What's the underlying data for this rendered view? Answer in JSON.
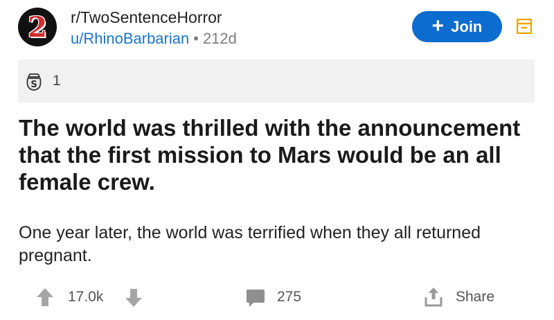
{
  "header": {
    "avatar_text": "2",
    "subreddit": "r/TwoSentenceHorror",
    "author": "u/RhinoBarbarian",
    "separator": "•",
    "age": "212d",
    "join_label": "Join",
    "join_icon": "+",
    "save_icon": "bookmark-icon"
  },
  "awards": {
    "icon": "award-icon",
    "count": "1"
  },
  "post": {
    "title": "The world was thrilled with the announcement that the first mission to Mars would be an all female crew.",
    "body": "One year later, the world was terrified when they all returned pregnant."
  },
  "actions": {
    "upvote_icon": "upvote-icon",
    "vote_count": "17.0k",
    "downvote_icon": "downvote-icon",
    "comment_icon": "comment-icon",
    "comment_count": "275",
    "share_icon": "share-icon",
    "share_label": "Share"
  },
  "colors": {
    "accent": "#0d6ccf",
    "link": "#1b74c9",
    "save_icon": "#f0a500",
    "flair_bg": "#f1f1f1",
    "action_icon": "#9a9a9a"
  }
}
